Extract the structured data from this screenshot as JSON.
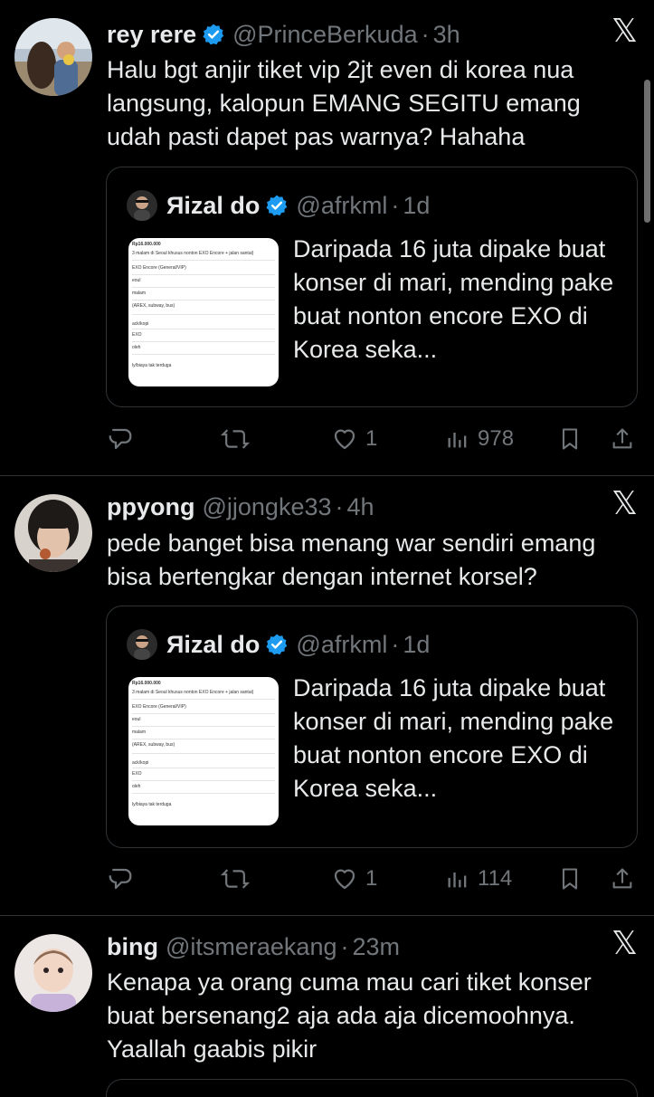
{
  "tweets": [
    {
      "name": "rey rere",
      "verified": true,
      "handle": "@PrinceBerkuda",
      "sep": "·",
      "time": "3h",
      "text": "Halu bgt anjir tiket vip 2jt even di korea nua langsung, kalopun EMANG SEGITU emang udah pasti dapet pas warnya? Hahaha",
      "quote": {
        "name": "Яizal do",
        "handle": "@afrkml",
        "sep": "·",
        "time": "1d",
        "text": "Daripada 16 juta dipake buat konser di mari, mending pake buat nonton encore EXO di Korea seka..."
      },
      "actions": {
        "reply": "",
        "retweet": "",
        "like": "1",
        "views": "978"
      }
    },
    {
      "name": "ppyong",
      "verified": false,
      "handle": "@jjongke33",
      "sep": "·",
      "time": "4h",
      "text": "pede banget bisa menang war sendiri emang bisa bertengkar dengan internet korsel?",
      "quote": {
        "name": "Яizal do",
        "handle": "@afrkml",
        "sep": "·",
        "time": "1d",
        "text": "Daripada 16 juta dipake buat konser di mari, mending pake buat nonton encore EXO di Korea seka..."
      },
      "actions": {
        "reply": "",
        "retweet": "",
        "like": "1",
        "views": "114"
      }
    },
    {
      "name": "bing",
      "verified": false,
      "handle": "@itsmeraekang",
      "sep": "·",
      "time": "23m",
      "text": "Kenapa ya orang cuma mau cari tiket konser buat bersenang2 aja ada aja dicemoohnya. Yaallah gaabis pikir"
    }
  ],
  "thumb": {
    "line1": "Rp16.000.000",
    "line2": "3 malam di Seoul khusus nonton EXO Encore + jalan santai)",
    "line3": "EXO Encore (General/VIP)",
    "line4": "eoul",
    "line5": "malam",
    "line6": "(AREX, subway, bus)",
    "line7": "ack/kopi",
    "line8": "EXO",
    "line9": "oleh",
    "line10": "ly/biaya tak terduga"
  },
  "icons": {
    "close": "x-logo-icon",
    "verified": "verified-badge-icon",
    "reply": "reply-icon",
    "retweet": "retweet-icon",
    "like": "heart-icon",
    "views": "views-icon",
    "bookmark": "bookmark-icon",
    "share": "share-icon"
  },
  "colors": {
    "background": "#000000",
    "text": "#e7e9ea",
    "muted": "#71767b",
    "verified": "#1d9bf0",
    "border": "#2f3336"
  }
}
